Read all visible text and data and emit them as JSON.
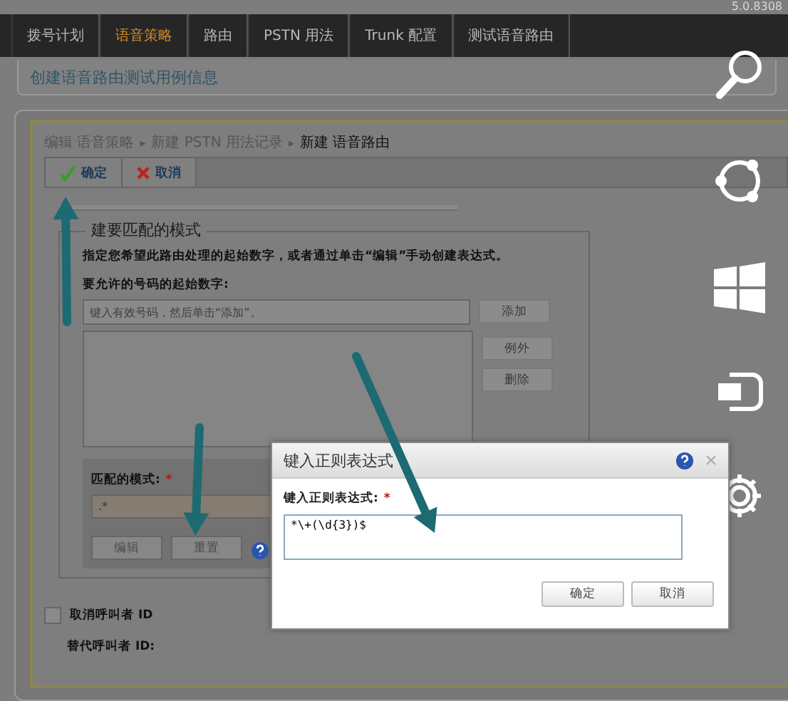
{
  "version": "5.0.8308",
  "tabs": [
    {
      "label": "拨号计划",
      "selected": false
    },
    {
      "label": "语音策略",
      "selected": true
    },
    {
      "label": "路由",
      "selected": false
    },
    {
      "label": "PSTN 用法",
      "selected": false
    },
    {
      "label": "Trunk 配置",
      "selected": false
    },
    {
      "label": "测试语音路由",
      "selected": false
    }
  ],
  "info_bar": "创建语音路由测试用例信息",
  "breadcrumb_separator": "▸",
  "breadcrumb": [
    {
      "label": "编辑 语音策略",
      "current": false
    },
    {
      "label": "新建 PSTN 用法记录",
      "current": false
    },
    {
      "label": "新建 语音路由",
      "current": true
    }
  ],
  "toolbar": [
    {
      "label": "确定",
      "kind": "ok"
    },
    {
      "label": "取消",
      "kind": "cancel"
    }
  ],
  "pattern_group": {
    "legend": "建要匹配的模式",
    "description": "指定您希望此路由处理的起始数字，或者通过单击“编辑”手动创建表达式。",
    "digits_label": "要允许的号码的起始数字:",
    "digits_placeholder": "键入有效号码，然后单击“添加”。",
    "side_buttons": [
      {
        "label": "添加"
      },
      {
        "label": "例外"
      },
      {
        "label": "删除"
      }
    ],
    "match_label": "匹配的模式:",
    "required": "*",
    "match_value": ".*",
    "buttons": [
      {
        "label": "编辑"
      },
      {
        "label": "重置"
      }
    ]
  },
  "suppress_caller_id": {
    "label": "取消呼叫者 ID",
    "checked": false
  },
  "alternate_caller_id": "替代呼叫者 ID:",
  "dialog": {
    "title": "键入正则表达式",
    "label": "键入正则表达式:",
    "required": "*",
    "value": "*\\+(\\d{3})$",
    "buttons": [
      "确定",
      "取消"
    ]
  }
}
